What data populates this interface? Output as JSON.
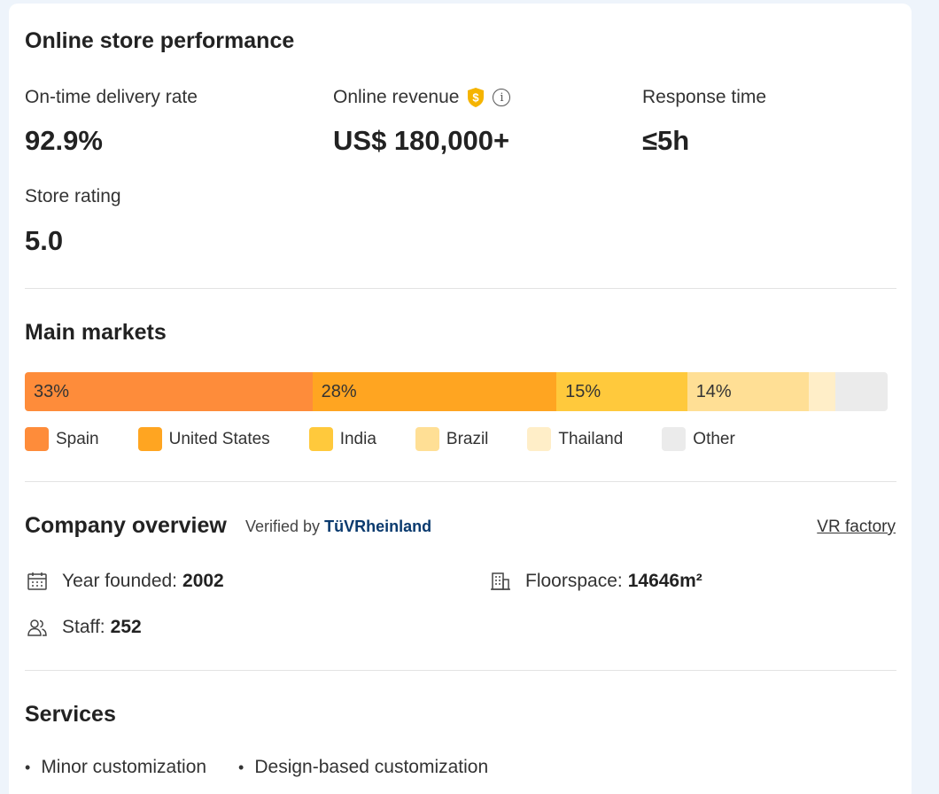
{
  "performance": {
    "title": "Online store performance",
    "metrics": [
      {
        "label": "On-time delivery rate",
        "value": "92.9%"
      },
      {
        "label": "Online revenue",
        "value": "US$ 180,000+"
      },
      {
        "label": "Response time",
        "value": "≤5h"
      },
      {
        "label": "Store rating",
        "value": "5.0"
      }
    ],
    "revenue_badge_icon": "shield-dollar-icon",
    "info_icon": "info-icon",
    "info_glyph": "i"
  },
  "markets": {
    "title": "Main markets",
    "segments": [
      {
        "name": "Spain",
        "percent": 33,
        "label": "33%",
        "color": "#fe8c3a"
      },
      {
        "name": "United States",
        "percent": 28,
        "label": "28%",
        "color": "#ffa521"
      },
      {
        "name": "India",
        "percent": 15,
        "label": "15%",
        "color": "#ffc93c"
      },
      {
        "name": "Brazil",
        "percent": 14,
        "label": "14%",
        "color": "#ffdf95"
      },
      {
        "name": "Thailand",
        "percent": 3,
        "label": "",
        "color": "#ffeec8"
      },
      {
        "name": "Other",
        "percent": 6,
        "label": "",
        "color": "#ebebeb"
      }
    ]
  },
  "company": {
    "title": "Company overview",
    "verified_prefix": "Verified by",
    "verified_by": "TüVRheinland",
    "vr_link": "VR factory",
    "year_founded_label": "Year founded:",
    "year_founded": "2002",
    "floorspace_label": "Floorspace:",
    "floorspace": "14646m²",
    "staff_label": "Staff:",
    "staff": "252"
  },
  "services": {
    "title": "Services",
    "items": [
      "Minor customization",
      "Design-based customization"
    ]
  }
}
